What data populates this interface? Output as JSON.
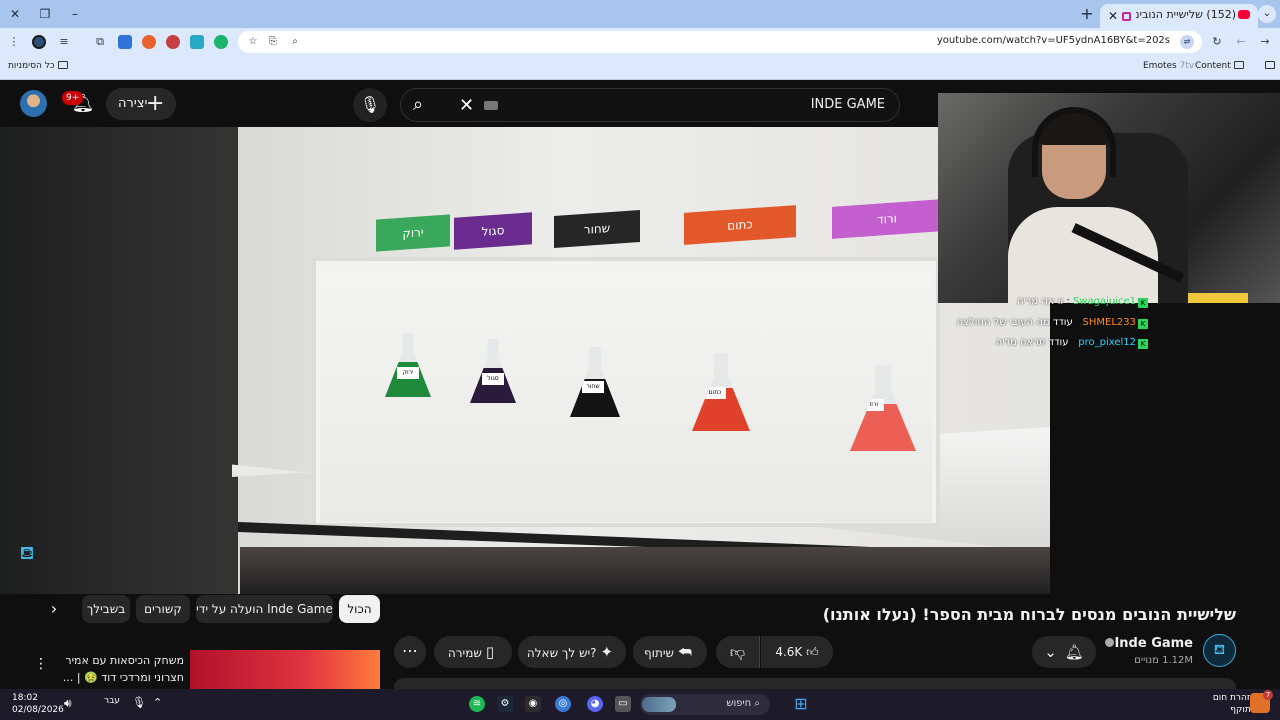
{
  "browser": {
    "tab_title": "(152) שלישיית הנובים מנסים",
    "url": "youtube.com/watch?v=UF5ydnA16BY&t=202s",
    "bookmarks": {
      "all_bookmarks": "כל הסימניות",
      "emotes": "Emotes",
      "content": "Content"
    }
  },
  "youtube": {
    "search_query": "INDE GAME",
    "create_label": "יצירה",
    "notification_count": "9+",
    "video": {
      "shelf_cards": [
        "ורוד",
        "כתום",
        "שחור",
        "סגול",
        "ירוק"
      ],
      "flask_labels": [
        "ורוד",
        "כתום",
        "שחור",
        "סגול",
        "ירוק"
      ],
      "chat": [
        {
          "user": "Swagajuice1",
          "message": "וו אה מריה",
          "color": "#2fd35c"
        },
        {
          "user": "SHMEL233",
          "message": "עודד מה העובי של החולצה",
          "color": "#ff8a1f"
        },
        {
          "user": "pro_pixel12",
          "message": "עודד תראה מדיה",
          "color": "#2dd0ff"
        }
      ]
    },
    "title": "שלישיית הנובים מנסים לברוח מבית הספר! (נעלו אותנו)",
    "channel": {
      "name": "Inde Game",
      "subscribers": "1.12M מנויים"
    },
    "actions": {
      "likes": "4.6K",
      "share": "שיתוף",
      "ask": "יש לך שאלה?",
      "save": "שמירה"
    },
    "chips": [
      "הכול",
      "הועלה על ידי Inde Game",
      "קשורים",
      "בשבילך"
    ],
    "recommendation": {
      "title": "משחק הכיסאות עם אמיר חצרוני ומרדכי דוד 🤢 | ..."
    }
  },
  "taskbar": {
    "time": "18:02",
    "date": "02/08/2026",
    "language": "עבר",
    "search": "חיפוש",
    "weather_title": "אזהרת חום",
    "weather_sub": "בתוקף",
    "weather_badge": "7"
  }
}
